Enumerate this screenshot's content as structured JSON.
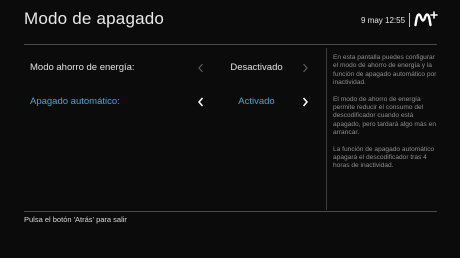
{
  "header": {
    "title": "Modo de apagado",
    "datetime": "9 may 12:55",
    "logo_name": "movistar-plus-logo"
  },
  "settings": [
    {
      "label": "Modo ahorro de energía:",
      "value": "Desactivado",
      "focused": false
    },
    {
      "label": "Apagado automático:",
      "value": "Activado",
      "focused": true
    }
  ],
  "help": {
    "paragraphs": [
      "En esta pantalla puedes configurar el modo de ahorro de energía y la función de apagado automático por inactividad.",
      "El modo de ahorro de energía permite reducir el consumo del descodificador cuando está apagado, pero tardará algo más en arrancar.",
      "La función de apagado automático apagará el descodificador tras 4 horas de inactividad."
    ]
  },
  "footer": {
    "hint": "Pulsa el botón 'Atrás' para salir"
  },
  "colors": {
    "background": "#0b0b0b",
    "focus": "#3fa3e6",
    "text": "#e0e0e0",
    "muted": "#8d8d8d"
  }
}
